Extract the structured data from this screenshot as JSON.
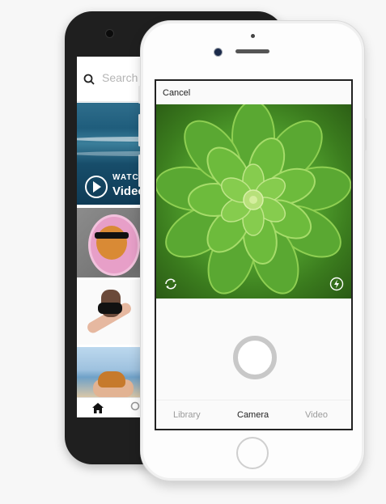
{
  "back_phone": {
    "search": {
      "placeholder": "Search"
    },
    "featured": {
      "label": "WATCH",
      "subtitle": "Videos"
    },
    "nav": {
      "home_icon": "home-icon",
      "search_icon": "search-icon"
    }
  },
  "camera": {
    "cancel_label": "Cancel",
    "tabs": [
      {
        "label": "Library",
        "active": false
      },
      {
        "label": "Camera",
        "active": true
      },
      {
        "label": "Video",
        "active": false
      }
    ],
    "icons": {
      "switch_camera": "switch-camera-icon",
      "flash": "flash-icon"
    }
  },
  "colors": {
    "succulent_green": "#5aa832",
    "back_phone_body": "#1f1f1f",
    "shutter_ring": "#c8c8c8"
  }
}
